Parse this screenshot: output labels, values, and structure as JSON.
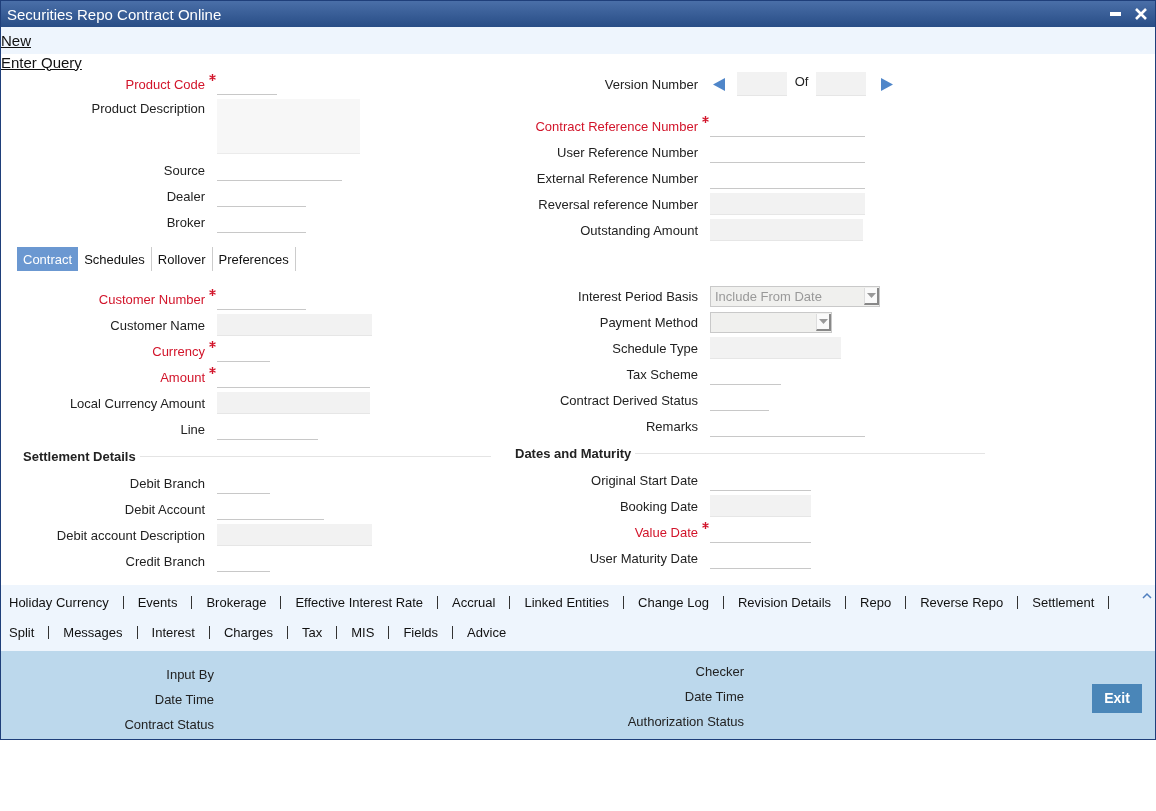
{
  "window": {
    "title": "Securities Repo Contract Online"
  },
  "toolbar": [
    "New",
    "Enter Query"
  ],
  "header": {
    "left": [
      {
        "label": "Product Code",
        "required": true,
        "kind": "input"
      },
      {
        "label": "Product Description",
        "required": false,
        "kind": "textarea"
      },
      {
        "label": "Source",
        "required": false,
        "kind": "input"
      },
      {
        "label": "Dealer",
        "required": false,
        "kind": "input"
      },
      {
        "label": "Broker",
        "required": false,
        "kind": "input"
      }
    ],
    "version": {
      "label": "Version Number",
      "of_label": "Of"
    },
    "right": [
      {
        "label": "Contract Reference Number",
        "required": true,
        "kind": "input"
      },
      {
        "label": "User Reference Number",
        "required": false,
        "kind": "input"
      },
      {
        "label": "External Reference Number",
        "required": false,
        "kind": "input"
      },
      {
        "label": "Reversal reference Number",
        "required": false,
        "kind": "readonly"
      },
      {
        "label": "Outstanding Amount",
        "required": false,
        "kind": "readonly"
      }
    ]
  },
  "tabs": [
    {
      "label": "Contract",
      "selected": true
    },
    {
      "label": "Schedules",
      "selected": false
    },
    {
      "label": "Rollover",
      "selected": false
    },
    {
      "label": "Preferences",
      "selected": false
    }
  ],
  "contract_tab": {
    "left": [
      {
        "label": "Customer Number",
        "required": true,
        "kind": "input"
      },
      {
        "label": "Customer Name",
        "required": false,
        "kind": "readonly"
      },
      {
        "label": "Currency",
        "required": true,
        "kind": "input"
      },
      {
        "label": "Amount",
        "required": true,
        "kind": "input"
      },
      {
        "label": "Local Currency Amount",
        "required": false,
        "kind": "readonly"
      },
      {
        "label": "Line",
        "required": false,
        "kind": "input"
      },
      {
        "label": "Settlement Details",
        "kind": "heading"
      },
      {
        "label": "Debit Branch",
        "required": false,
        "kind": "input"
      },
      {
        "label": "Debit Account",
        "required": false,
        "kind": "input"
      },
      {
        "label": "Debit account Description",
        "required": false,
        "kind": "readonly"
      },
      {
        "label": "Credit Branch",
        "required": false,
        "kind": "input"
      }
    ],
    "right": [
      {
        "label": "Interest Period Basis",
        "required": false,
        "kind": "select",
        "value": "Include From Date"
      },
      {
        "label": "Payment Method",
        "required": false,
        "kind": "select"
      },
      {
        "label": "Schedule Type",
        "required": false,
        "kind": "readonly"
      },
      {
        "label": "Tax Scheme",
        "required": false,
        "kind": "input"
      },
      {
        "label": "Contract Derived Status",
        "required": false,
        "kind": "input"
      },
      {
        "label": "Remarks",
        "required": false,
        "kind": "input"
      },
      {
        "label": "Dates and Maturity",
        "kind": "heading"
      },
      {
        "label": "Original Start Date",
        "required": false,
        "kind": "input"
      },
      {
        "label": "Booking Date",
        "required": false,
        "kind": "readonly"
      },
      {
        "label": "Value Date",
        "required": true,
        "kind": "input"
      },
      {
        "label": "User Maturity Date",
        "required": false,
        "kind": "input"
      }
    ]
  },
  "links": [
    [
      "Holiday Currency",
      "Events",
      "Brokerage",
      "Effective Interest Rate",
      "Accrual",
      "Linked Entities",
      "Change Log",
      "Revision Details",
      "Repo",
      "Reverse Repo",
      "Settlement"
    ],
    [
      "Split",
      "Messages",
      "Interest",
      "Charges",
      "Tax",
      "MIS",
      "Fields",
      "Advice"
    ]
  ],
  "audit": {
    "left": [
      "Input By",
      "Date Time",
      "Contract Status"
    ],
    "right": [
      "Checker",
      "Date Time",
      "Authorization Status"
    ]
  },
  "exit_button": "Exit"
}
